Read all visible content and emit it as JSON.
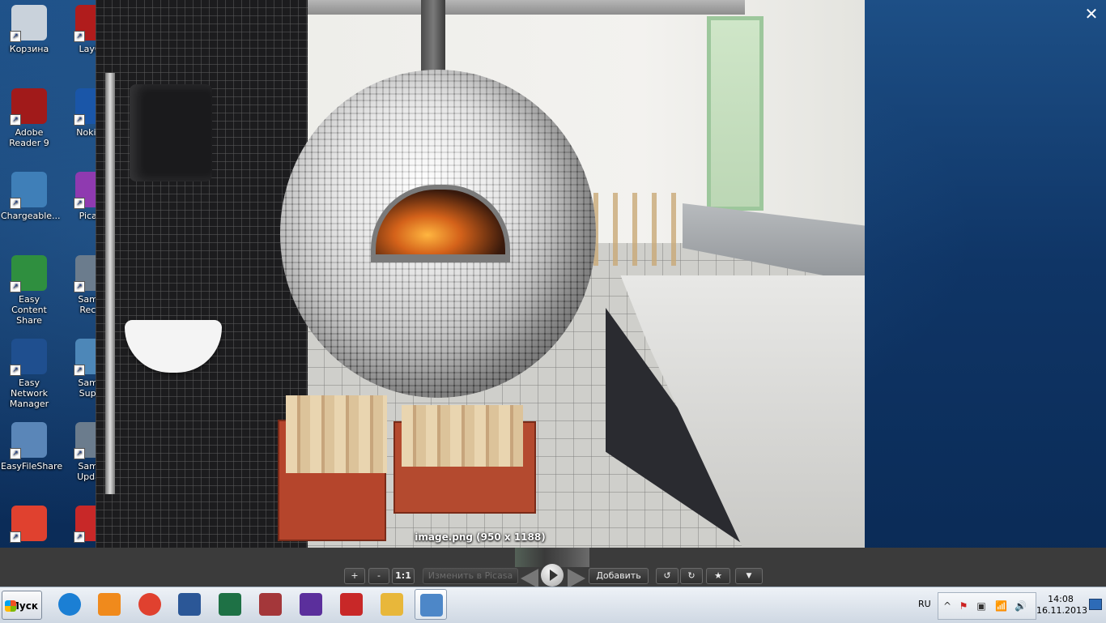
{
  "desktop": {
    "icons_col1": [
      {
        "name": "korzina",
        "label": "Корзина",
        "icon": "recycle-bin-icon",
        "color": "#c9d2db"
      },
      {
        "name": "adobe-reader",
        "label": "Adobe Reader 9",
        "icon": "adobe-reader-icon",
        "color": "#a11a1a"
      },
      {
        "name": "chargeable",
        "label": "Chargeable...",
        "icon": "chargeable-icon",
        "color": "#3f7fb8"
      },
      {
        "name": "easy-content-share",
        "label": "Easy Content Share",
        "icon": "easy-content-share-icon",
        "color": "#2f8f3f"
      },
      {
        "name": "easy-network-manager",
        "label": "Easy Network Manager",
        "icon": "easy-network-manager-icon",
        "color": "#1f4f8f"
      },
      {
        "name": "easyfileshare",
        "label": "EasyFileShare",
        "icon": "easyfileshare-icon",
        "color": "#5a86b8"
      },
      {
        "name": "chrome",
        "label": "",
        "icon": "chrome-icon",
        "color": "#e0412f"
      }
    ],
    "icons_col2": [
      {
        "name": "layout",
        "label": "LayOu",
        "icon": "layout-icon",
        "color": "#b01c1c"
      },
      {
        "name": "nokia",
        "label": "Nokia S",
        "icon": "nokia-icon",
        "color": "#1a56a8"
      },
      {
        "name": "picasa",
        "label": "Picasa",
        "icon": "picasa-icon",
        "color": "#8f3ab0"
      },
      {
        "name": "samsung-recovery",
        "label": "Samsu Recov",
        "icon": "samsung-recovery-icon",
        "color": "#6b7c8d"
      },
      {
        "name": "samsung-support",
        "label": "Samsu Suppo",
        "icon": "samsung-support-icon",
        "color": "#4d87b8"
      },
      {
        "name": "samsung-update",
        "label": "Samsu Update",
        "icon": "samsung-update-icon",
        "color": "#6b7c8d"
      },
      {
        "name": "sketchup",
        "label": "",
        "icon": "sketchup-icon",
        "color": "#c82828"
      }
    ]
  },
  "viewer": {
    "caption": "image.png (950 x 1188)",
    "close_glyph": "✕",
    "toolbar": {
      "zoom_in": "+",
      "zoom_out": "-",
      "actual_size": "1:1",
      "edit_in_picasa": "Изменить в Picasa",
      "add": "Добавить",
      "rotate_left_glyph": "↺",
      "rotate_right_glyph": "↻",
      "star_glyph": "★",
      "more_glyph": "▼"
    }
  },
  "taskbar": {
    "start_label": "Пуск",
    "apps": [
      {
        "name": "ie",
        "icon": "internet-explorer-icon",
        "color": "#1b7fd4"
      },
      {
        "name": "media",
        "icon": "media-player-icon",
        "color": "#f08a1c"
      },
      {
        "name": "chrome",
        "icon": "chrome-icon",
        "color": "#e0412f"
      },
      {
        "name": "word",
        "icon": "word-icon",
        "color": "#2b5797"
      },
      {
        "name": "excel",
        "icon": "excel-icon",
        "color": "#1e7145"
      },
      {
        "name": "access",
        "icon": "access-icon",
        "color": "#a4373a"
      },
      {
        "name": "audio",
        "icon": "audio-editor-icon",
        "color": "#5b2f9c"
      },
      {
        "name": "sketchup",
        "icon": "sketchup-icon",
        "color": "#c82828"
      },
      {
        "name": "explorer",
        "icon": "file-explorer-icon",
        "color": "#e8b73a"
      },
      {
        "name": "picasa-viewer",
        "icon": "picasa-photo-viewer-icon",
        "color": "#4d87c8"
      }
    ],
    "language": "RU",
    "tray_icons": [
      "^",
      "⚑",
      "▣",
      "📶",
      "🔊"
    ],
    "time": "14:08",
    "date": "16.11.2013"
  }
}
